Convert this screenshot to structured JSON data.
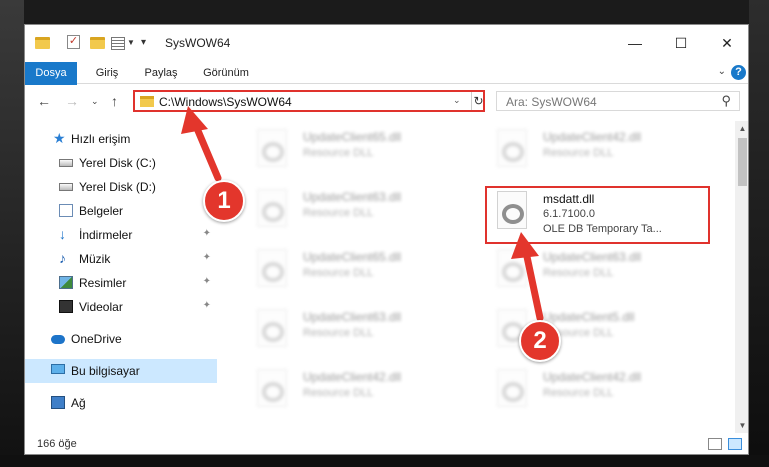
{
  "window": {
    "title": "SysWOW64",
    "minimize_glyph": "—",
    "maximize_glyph": "☐",
    "close_glyph": "✕"
  },
  "ribbon": {
    "tabs": [
      {
        "label": "Dosya"
      },
      {
        "label": "Giriş"
      },
      {
        "label": "Paylaş"
      },
      {
        "label": "Görünüm"
      }
    ],
    "help_glyph": "?"
  },
  "address": {
    "path": "C:\\Windows\\SysWOW64"
  },
  "search": {
    "placeholder": "Ara: SysWOW64"
  },
  "nav": {
    "items": [
      {
        "label": "Hızlı erişim",
        "icon": "star-icon"
      },
      {
        "label": "Yerel Disk (C:)",
        "icon": "drive-icon"
      },
      {
        "label": "Yerel Disk (D:)",
        "icon": "drive-icon"
      },
      {
        "label": "Belgeler",
        "icon": "documents-icon"
      },
      {
        "label": "İndirmeler",
        "icon": "downloads-icon"
      },
      {
        "label": "Müzik",
        "icon": "music-icon"
      },
      {
        "label": "Resimler",
        "icon": "pictures-icon"
      },
      {
        "label": "Videolar",
        "icon": "videos-icon"
      },
      {
        "label": "OneDrive",
        "icon": "cloud-icon"
      },
      {
        "label": "Bu bilgisayar",
        "icon": "computer-icon"
      },
      {
        "label": "Ağ",
        "icon": "network-icon"
      }
    ]
  },
  "files": {
    "left": [
      {
        "name": "UpdateClient65.dll",
        "type": "Resource DLL"
      },
      {
        "name": "UpdateClient63.dll",
        "type": "Resource DLL"
      },
      {
        "name": "UpdateClient65.dll",
        "type": "Resource DLL"
      },
      {
        "name": "UpdateClient63.dll",
        "type": "Resource DLL"
      },
      {
        "name": "UpdateClient42.dll",
        "type": "Resource DLL"
      }
    ],
    "right": [
      {
        "name": "UpdateClient42.dll",
        "type": "Resource DLL"
      },
      {
        "name": "UpdateClient63.dll",
        "type": "Resource DLL"
      },
      {
        "name": "UpdateClient5.dll",
        "type": "Resource DLL"
      },
      {
        "name": "UpdateClient42.dll",
        "type": "Resource DLL"
      }
    ],
    "highlighted": {
      "name": "msdatt.dll",
      "version": "6.1.7100.0",
      "description": "OLE DB Temporary Ta..."
    }
  },
  "status": {
    "count": "166 öğe"
  },
  "annotations": {
    "step1": "1",
    "step2": "2",
    "color": "#e3362c"
  }
}
